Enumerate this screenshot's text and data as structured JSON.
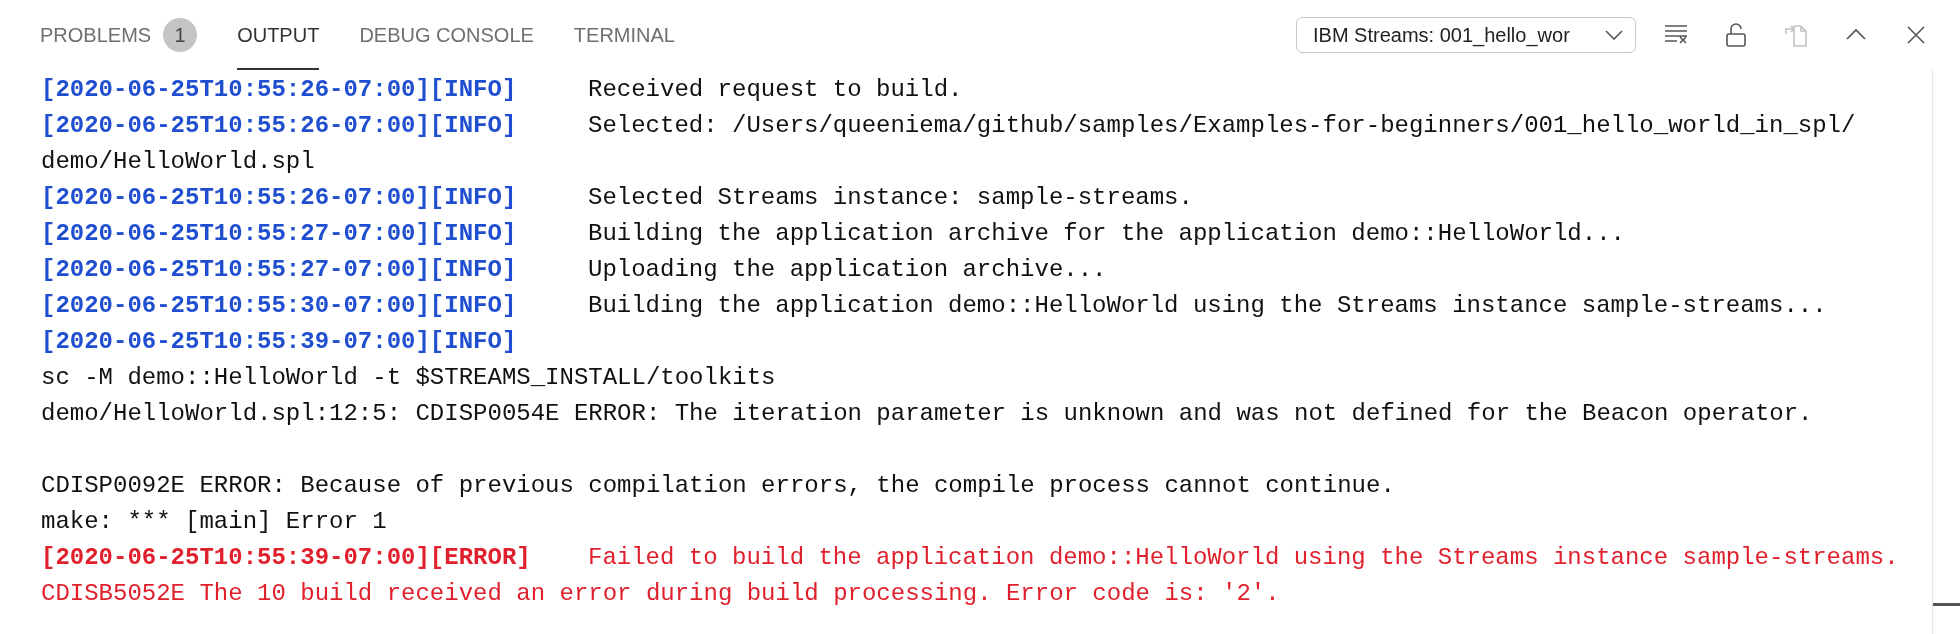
{
  "tabs": [
    {
      "label": "PROBLEMS",
      "badge": "1",
      "selected": false
    },
    {
      "label": "OUTPUT",
      "selected": true
    },
    {
      "label": "DEBUG CONSOLE",
      "selected": false
    },
    {
      "label": "TERMINAL",
      "selected": false
    }
  ],
  "output_channel": {
    "value": "IBM Streams: 001_hello_wor"
  },
  "toolbar": [
    {
      "kind": "clear",
      "disabled": false
    },
    {
      "kind": "lock",
      "disabled": false
    },
    {
      "kind": "copy",
      "disabled": true
    },
    {
      "kind": "maximize",
      "disabled": false
    },
    {
      "kind": "close",
      "disabled": false
    }
  ],
  "lines": [
    {
      "kind": "info",
      "tag": "[2020-06-25T10:55:26-07:00][INFO]",
      "message": "Received request to build."
    },
    {
      "kind": "info",
      "tag": "[2020-06-25T10:55:26-07:00][INFO]",
      "message": "Selected: /Users/queeniema/github/samples/Examples-for-beginners/001_hello_world_in_spl/"
    },
    {
      "kind": "plain",
      "message": "demo/HelloWorld.spl"
    },
    {
      "kind": "info",
      "tag": "[2020-06-25T10:55:26-07:00][INFO]",
      "message": "Selected Streams instance: sample-streams."
    },
    {
      "kind": "info",
      "tag": "[2020-06-25T10:55:27-07:00][INFO]",
      "message": "Building the application archive for the application demo::HelloWorld..."
    },
    {
      "kind": "info",
      "tag": "[2020-06-25T10:55:27-07:00][INFO]",
      "message": "Uploading the application archive..."
    },
    {
      "kind": "info",
      "tag": "[2020-06-25T10:55:30-07:00][INFO]",
      "message": "Building the application demo::HelloWorld using the Streams instance sample-streams..."
    },
    {
      "kind": "info",
      "tag": "[2020-06-25T10:55:39-07:00][INFO]"
    },
    {
      "kind": "plain",
      "message": "sc -M demo::HelloWorld -t $STREAMS_INSTALL/toolkits"
    },
    {
      "kind": "plain",
      "message": "demo/HelloWorld.spl:12:5: CDISP0054E ERROR: The iteration parameter is unknown and was not defined for the Beacon operator."
    },
    {
      "kind": "blank"
    },
    {
      "kind": "plain",
      "message": "CDISP0092E ERROR: Because of previous compilation errors, the compile process cannot continue."
    },
    {
      "kind": "plain",
      "message": "make: *** [main] Error 1"
    },
    {
      "kind": "error",
      "tag": "[2020-06-25T10:55:39-07:00][ERROR]",
      "message": "Failed to build the application demo::HelloWorld using the Streams instance sample-streams."
    },
    {
      "kind": "error_text",
      "message": "CDISB5052E The 10 build received an error during build processing. Error code is: '2'."
    }
  ]
}
